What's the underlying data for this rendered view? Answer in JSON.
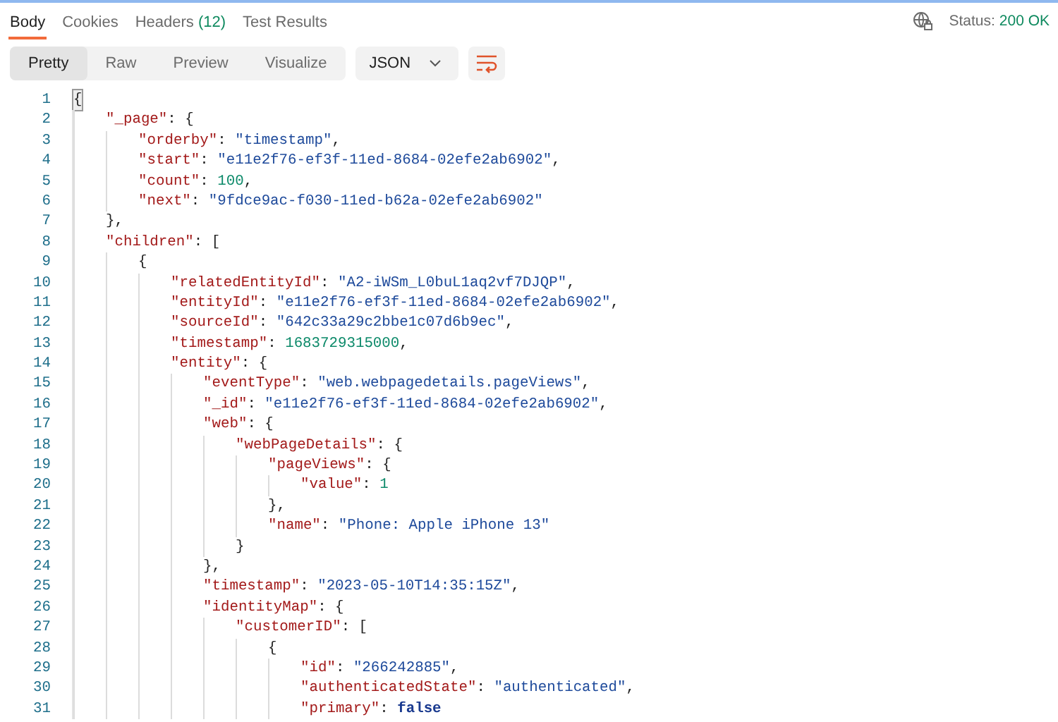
{
  "tabs": [
    {
      "label": "Body",
      "selected": true
    },
    {
      "label": "Cookies",
      "selected": false
    },
    {
      "label": "Headers",
      "count": "(12)",
      "selected": false
    },
    {
      "label": "Test Results",
      "selected": false
    }
  ],
  "status": {
    "label": "Status:",
    "value": "200 OK"
  },
  "view_modes": [
    {
      "label": "Pretty",
      "selected": true
    },
    {
      "label": "Raw",
      "selected": false
    },
    {
      "label": "Preview",
      "selected": false
    },
    {
      "label": "Visualize",
      "selected": false
    }
  ],
  "format": {
    "value": "JSON"
  },
  "code_lines": [
    {
      "number": "1",
      "tokens": [
        {
          "kind": "bracket",
          "text": "{"
        }
      ],
      "children": [
        {
          "number": "2",
          "tokens": [
            {
              "kind": "key",
              "text": "\"_page\""
            },
            {
              "kind": "punct",
              "text": ": {"
            }
          ],
          "children": [
            {
              "number": "3",
              "tokens": [
                {
                  "kind": "key",
                  "text": "\"orderby\""
                },
                {
                  "kind": "punct",
                  "text": ": "
                },
                {
                  "kind": "string",
                  "text": "\"timestamp\""
                },
                {
                  "kind": "punct",
                  "text": ","
                }
              ]
            },
            {
              "number": "4",
              "tokens": [
                {
                  "kind": "key",
                  "text": "\"start\""
                },
                {
                  "kind": "punct",
                  "text": ": "
                },
                {
                  "kind": "string",
                  "text": "\"e11e2f76-ef3f-11ed-8684-02efe2ab6902\""
                },
                {
                  "kind": "punct",
                  "text": ","
                }
              ]
            },
            {
              "number": "5",
              "tokens": [
                {
                  "kind": "key",
                  "text": "\"count\""
                },
                {
                  "kind": "punct",
                  "text": ": "
                },
                {
                  "kind": "number",
                  "text": "100"
                },
                {
                  "kind": "punct",
                  "text": ","
                }
              ]
            },
            {
              "number": "6",
              "tokens": [
                {
                  "kind": "key",
                  "text": "\"next\""
                },
                {
                  "kind": "punct",
                  "text": ": "
                },
                {
                  "kind": "string",
                  "text": "\"9fdce9ac-f030-11ed-b62a-02efe2ab6902\""
                }
              ]
            }
          ]
        },
        {
          "number": "7",
          "tokens": [
            {
              "kind": "punct",
              "text": "},"
            }
          ]
        },
        {
          "number": "8",
          "tokens": [
            {
              "kind": "key",
              "text": "\"children\""
            },
            {
              "kind": "punct",
              "text": ": ["
            }
          ],
          "children": [
            {
              "number": "9",
              "tokens": [
                {
                  "kind": "punct",
                  "text": "{"
                }
              ],
              "children": [
                {
                  "number": "10",
                  "tokens": [
                    {
                      "kind": "key",
                      "text": "\"relatedEntityId\""
                    },
                    {
                      "kind": "punct",
                      "text": ": "
                    },
                    {
                      "kind": "string",
                      "text": "\"A2-iWSm_L0buL1aq2vf7DJQP\""
                    },
                    {
                      "kind": "punct",
                      "text": ","
                    }
                  ]
                },
                {
                  "number": "11",
                  "tokens": [
                    {
                      "kind": "key",
                      "text": "\"entityId\""
                    },
                    {
                      "kind": "punct",
                      "text": ": "
                    },
                    {
                      "kind": "string",
                      "text": "\"e11e2f76-ef3f-11ed-8684-02efe2ab6902\""
                    },
                    {
                      "kind": "punct",
                      "text": ","
                    }
                  ]
                },
                {
                  "number": "12",
                  "tokens": [
                    {
                      "kind": "key",
                      "text": "\"sourceId\""
                    },
                    {
                      "kind": "punct",
                      "text": ": "
                    },
                    {
                      "kind": "string",
                      "text": "\"642c33a29c2bbe1c07d6b9ec\""
                    },
                    {
                      "kind": "punct",
                      "text": ","
                    }
                  ]
                },
                {
                  "number": "13",
                  "tokens": [
                    {
                      "kind": "key",
                      "text": "\"timestamp\""
                    },
                    {
                      "kind": "punct",
                      "text": ": "
                    },
                    {
                      "kind": "number",
                      "text": "1683729315000"
                    },
                    {
                      "kind": "punct",
                      "text": ","
                    }
                  ]
                },
                {
                  "number": "14",
                  "tokens": [
                    {
                      "kind": "key",
                      "text": "\"entity\""
                    },
                    {
                      "kind": "punct",
                      "text": ": {"
                    }
                  ],
                  "children": [
                    {
                      "number": "15",
                      "tokens": [
                        {
                          "kind": "key",
                          "text": "\"eventType\""
                        },
                        {
                          "kind": "punct",
                          "text": ": "
                        },
                        {
                          "kind": "string",
                          "text": "\"web.webpagedetails.pageViews\""
                        },
                        {
                          "kind": "punct",
                          "text": ","
                        }
                      ]
                    },
                    {
                      "number": "16",
                      "tokens": [
                        {
                          "kind": "key",
                          "text": "\"_id\""
                        },
                        {
                          "kind": "punct",
                          "text": ": "
                        },
                        {
                          "kind": "string",
                          "text": "\"e11e2f76-ef3f-11ed-8684-02efe2ab6902\""
                        },
                        {
                          "kind": "punct",
                          "text": ","
                        }
                      ]
                    },
                    {
                      "number": "17",
                      "tokens": [
                        {
                          "kind": "key",
                          "text": "\"web\""
                        },
                        {
                          "kind": "punct",
                          "text": ": {"
                        }
                      ],
                      "children": [
                        {
                          "number": "18",
                          "tokens": [
                            {
                              "kind": "key",
                              "text": "\"webPageDetails\""
                            },
                            {
                              "kind": "punct",
                              "text": ": {"
                            }
                          ],
                          "children": [
                            {
                              "number": "19",
                              "tokens": [
                                {
                                  "kind": "key",
                                  "text": "\"pageViews\""
                                },
                                {
                                  "kind": "punct",
                                  "text": ": {"
                                }
                              ],
                              "children": [
                                {
                                  "number": "20",
                                  "tokens": [
                                    {
                                      "kind": "key",
                                      "text": "\"value\""
                                    },
                                    {
                                      "kind": "punct",
                                      "text": ": "
                                    },
                                    {
                                      "kind": "number",
                                      "text": "1"
                                    }
                                  ]
                                }
                              ]
                            },
                            {
                              "number": "21",
                              "tokens": [
                                {
                                  "kind": "punct",
                                  "text": "},"
                                }
                              ]
                            },
                            {
                              "number": "22",
                              "tokens": [
                                {
                                  "kind": "key",
                                  "text": "\"name\""
                                },
                                {
                                  "kind": "punct",
                                  "text": ": "
                                },
                                {
                                  "kind": "string",
                                  "text": "\"Phone: Apple iPhone 13\""
                                }
                              ]
                            }
                          ]
                        },
                        {
                          "number": "23",
                          "tokens": [
                            {
                              "kind": "punct",
                              "text": "}"
                            }
                          ]
                        }
                      ]
                    },
                    {
                      "number": "24",
                      "tokens": [
                        {
                          "kind": "punct",
                          "text": "},"
                        }
                      ]
                    },
                    {
                      "number": "25",
                      "tokens": [
                        {
                          "kind": "key",
                          "text": "\"timestamp\""
                        },
                        {
                          "kind": "punct",
                          "text": ": "
                        },
                        {
                          "kind": "string",
                          "text": "\"2023-05-10T14:35:15Z\""
                        },
                        {
                          "kind": "punct",
                          "text": ","
                        }
                      ]
                    },
                    {
                      "number": "26",
                      "tokens": [
                        {
                          "kind": "key",
                          "text": "\"identityMap\""
                        },
                        {
                          "kind": "punct",
                          "text": ": {"
                        }
                      ],
                      "children": [
                        {
                          "number": "27",
                          "tokens": [
                            {
                              "kind": "key",
                              "text": "\"customerID\""
                            },
                            {
                              "kind": "punct",
                              "text": ": ["
                            }
                          ],
                          "children": [
                            {
                              "number": "28",
                              "tokens": [
                                {
                                  "kind": "punct",
                                  "text": "{"
                                }
                              ],
                              "children": [
                                {
                                  "number": "29",
                                  "tokens": [
                                    {
                                      "kind": "key",
                                      "text": "\"id\""
                                    },
                                    {
                                      "kind": "punct",
                                      "text": ": "
                                    },
                                    {
                                      "kind": "string",
                                      "text": "\"266242885\""
                                    },
                                    {
                                      "kind": "punct",
                                      "text": ","
                                    }
                                  ]
                                },
                                {
                                  "number": "30",
                                  "tokens": [
                                    {
                                      "kind": "key",
                                      "text": "\"authenticatedState\""
                                    },
                                    {
                                      "kind": "punct",
                                      "text": ": "
                                    },
                                    {
                                      "kind": "string",
                                      "text": "\"authenticated\""
                                    },
                                    {
                                      "kind": "punct",
                                      "text": ","
                                    }
                                  ]
                                },
                                {
                                  "number": "31",
                                  "tokens": [
                                    {
                                      "kind": "key",
                                      "text": "\"primary\""
                                    },
                                    {
                                      "kind": "punct",
                                      "text": ": "
                                    },
                                    {
                                      "kind": "boolean",
                                      "text": "false"
                                    }
                                  ]
                                }
                              ]
                            }
                          ]
                        }
                      ]
                    }
                  ]
                }
              ]
            }
          ]
        }
      ]
    }
  ]
}
